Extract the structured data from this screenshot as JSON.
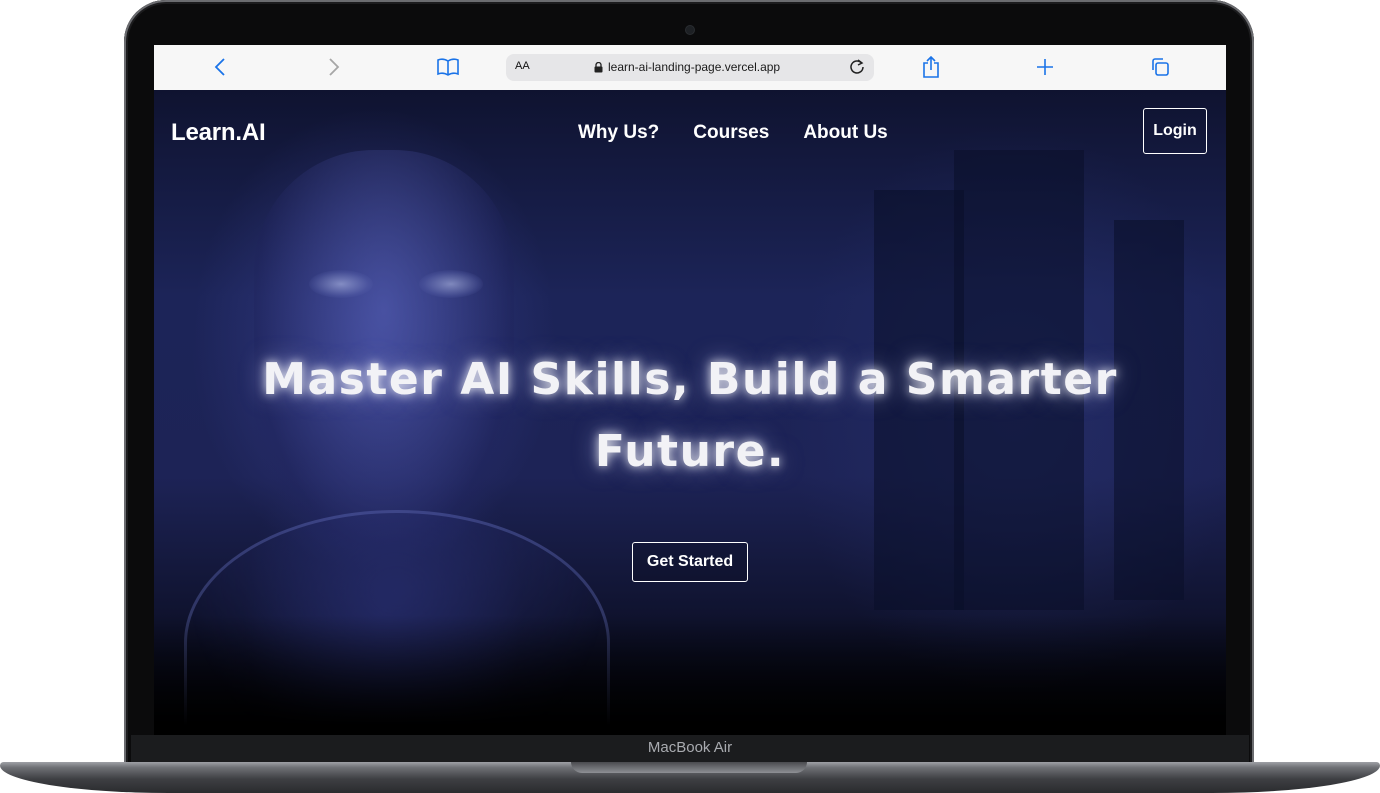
{
  "device": {
    "label": "MacBook Air"
  },
  "browser": {
    "text_size_label": "AA",
    "url": "learn-ai-landing-page.vercel.app",
    "accent_color": "#1a73e8"
  },
  "site": {
    "logo": "Learn.AI",
    "nav": [
      "Why Us?",
      "Courses",
      "About Us"
    ],
    "login_label": "Login",
    "hero_title": "Master AI Skills, Build a Smarter Future.",
    "cta_label": "Get Started"
  }
}
